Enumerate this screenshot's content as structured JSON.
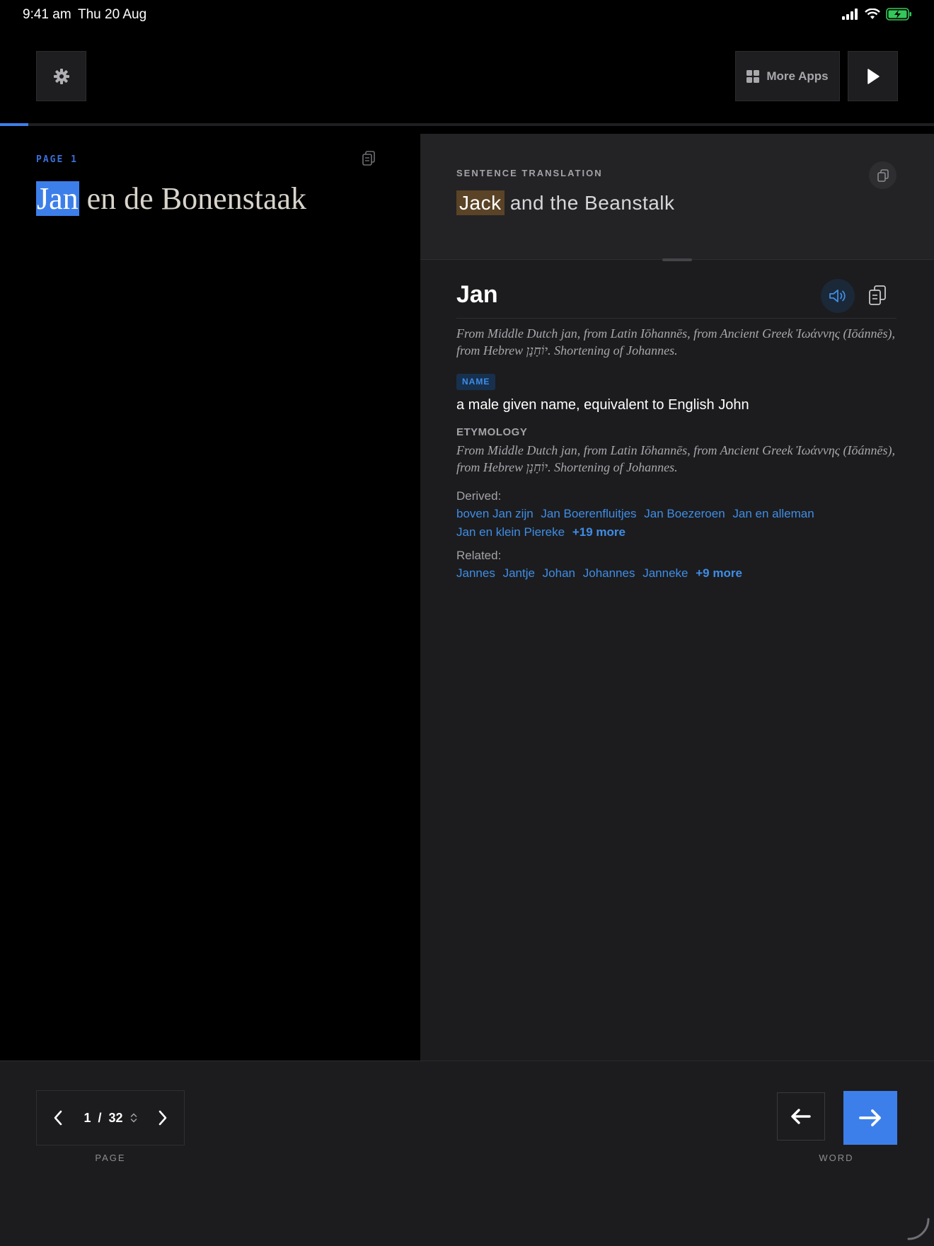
{
  "status_bar": {
    "time": "9:41 am",
    "date": "Thu 20 Aug"
  },
  "toolbar": {
    "more_apps_label": "More Apps",
    "reading_progress_fraction": 0.03
  },
  "source": {
    "page_label": "PAGE 1",
    "highlighted_word": "Jan",
    "rest_of_sentence": " en de Bonenstaak"
  },
  "translation": {
    "label": "SENTENCE TRANSLATION",
    "highlighted_word": "Jack",
    "rest_of_sentence": " and the Beanstalk"
  },
  "entry": {
    "word": "Jan",
    "etymology_summary": "From Middle Dutch jan, from Latin Iōhannēs, from Ancient Greek Ἰωάννης (Iōánnēs), from Hebrew יוֹחָנָן. Shortening of Johannes.",
    "part_of_speech": "NAME",
    "definition": "a male given name, equivalent to English John",
    "etymology_heading": "ETYMOLOGY",
    "etymology_text": "From Middle Dutch jan, from Latin Iōhannēs, from Ancient Greek Ἰωάννης (Iōánnēs), from Hebrew יוֹחָנָן. Shortening of Johannes.",
    "derived_label": "Derived:",
    "derived": [
      "boven Jan zijn",
      "Jan Boerenfluitjes",
      "Jan Boezeroen",
      "Jan en alleman",
      "Jan en klein Piereke"
    ],
    "derived_more": "+19 more",
    "related_label": "Related:",
    "related": [
      "Jannes",
      "Jantje",
      "Johan",
      "Johannes",
      "Janneke"
    ],
    "related_more": "+9 more"
  },
  "pager": {
    "current": "1",
    "separator": "/",
    "total": "32",
    "caption": "PAGE"
  },
  "word_nav": {
    "caption": "WORD"
  },
  "colors": {
    "accent": "#3d7fea",
    "link": "#3f8de6",
    "translation_highlight": "#5a4326"
  },
  "icons": [
    "gear-icon",
    "grid-icon",
    "play-icon",
    "copy-icon",
    "speaker-icon",
    "chevron-left-icon",
    "chevron-right-icon",
    "sort-icon",
    "arrow-left-icon",
    "arrow-right-icon"
  ]
}
